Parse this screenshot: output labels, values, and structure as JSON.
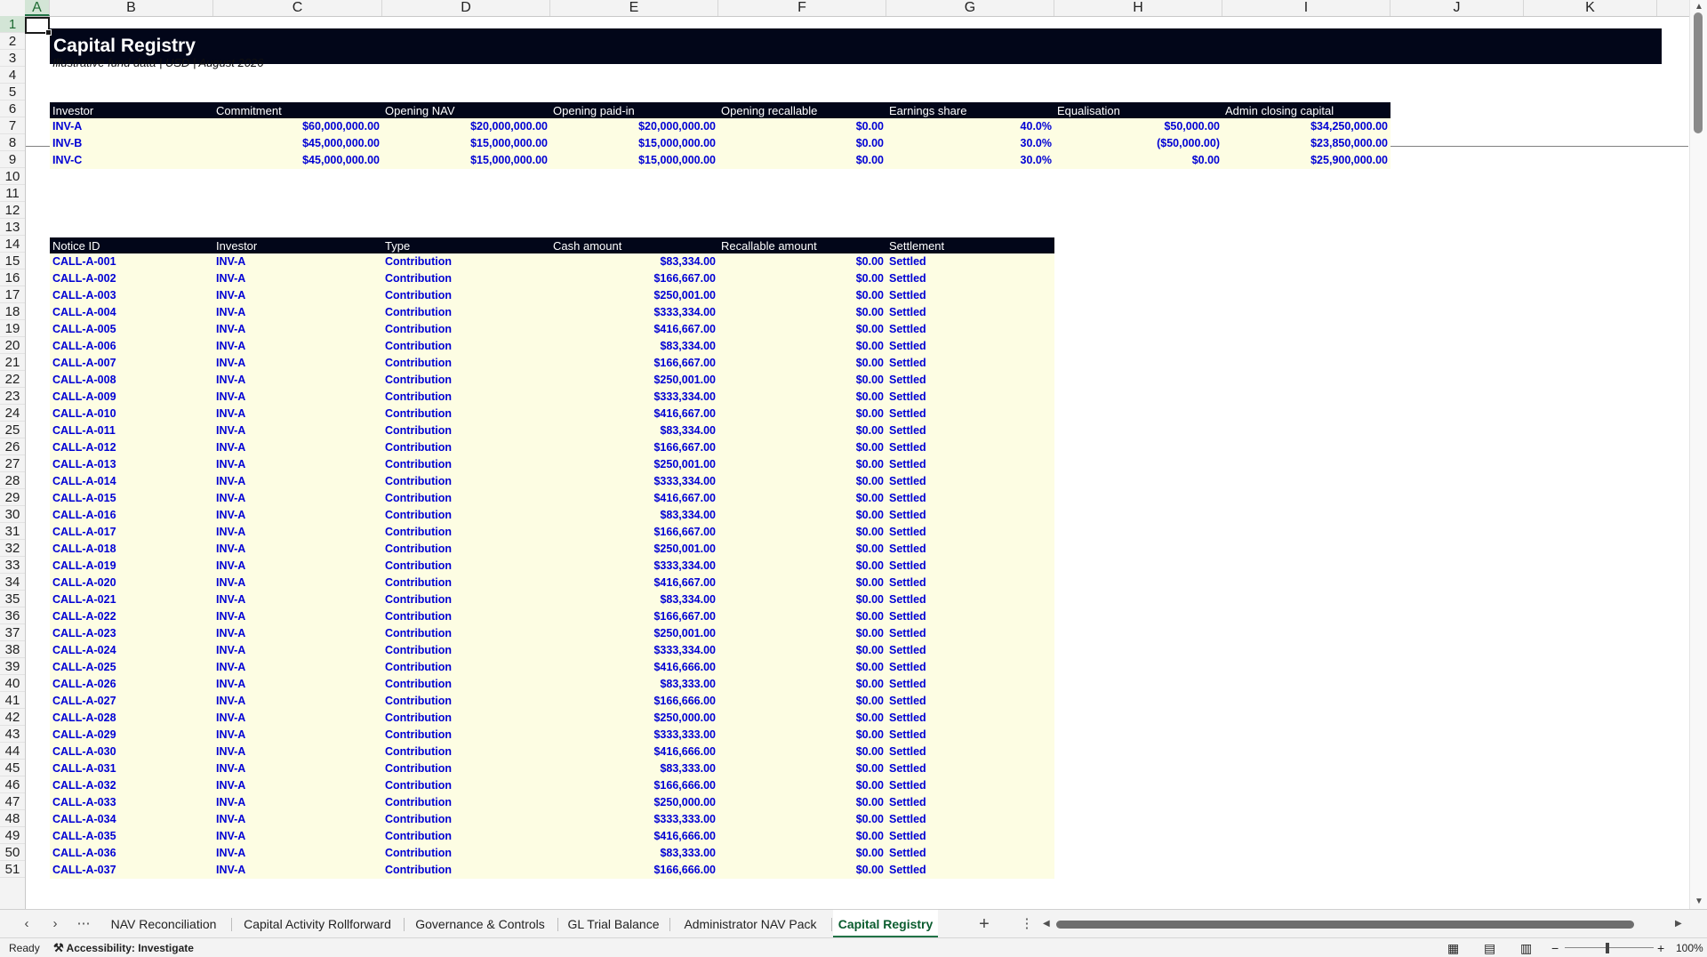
{
  "columns": [
    "A",
    "B",
    "C",
    "D",
    "E",
    "F",
    "G",
    "H",
    "I",
    "J",
    "K"
  ],
  "rows_start": 1,
  "rows_end": 51,
  "selected_cell": "A1",
  "title": "Capital Registry",
  "subtitle": "Illustrative fund data | USD | August 2026",
  "investor_table": {
    "headers": [
      "Investor",
      "Commitment",
      "Opening NAV",
      "Opening paid-in",
      "Opening recallable",
      "Earnings share",
      "Equalisation",
      "Admin closing capital"
    ],
    "rows": [
      [
        "INV-A",
        "$60,000,000.00",
        "$20,000,000.00",
        "$20,000,000.00",
        "$0.00",
        "40.0%",
        "$50,000.00",
        "$34,250,000.00"
      ],
      [
        "INV-B",
        "$45,000,000.00",
        "$15,000,000.00",
        "$15,000,000.00",
        "$0.00",
        "30.0%",
        "($50,000.00)",
        "$23,850,000.00"
      ],
      [
        "INV-C",
        "$45,000,000.00",
        "$15,000,000.00",
        "$15,000,000.00",
        "$0.00",
        "30.0%",
        "$0.00",
        "$25,900,000.00"
      ]
    ]
  },
  "notice_table": {
    "headers": [
      "Notice ID",
      "Investor",
      "Type",
      "Cash amount",
      "Recallable amount",
      "Settlement"
    ],
    "rows": [
      [
        "CALL-A-001",
        "INV-A",
        "Contribution",
        "$83,334.00",
        "$0.00",
        "Settled"
      ],
      [
        "CALL-A-002",
        "INV-A",
        "Contribution",
        "$166,667.00",
        "$0.00",
        "Settled"
      ],
      [
        "CALL-A-003",
        "INV-A",
        "Contribution",
        "$250,001.00",
        "$0.00",
        "Settled"
      ],
      [
        "CALL-A-004",
        "INV-A",
        "Contribution",
        "$333,334.00",
        "$0.00",
        "Settled"
      ],
      [
        "CALL-A-005",
        "INV-A",
        "Contribution",
        "$416,667.00",
        "$0.00",
        "Settled"
      ],
      [
        "CALL-A-006",
        "INV-A",
        "Contribution",
        "$83,334.00",
        "$0.00",
        "Settled"
      ],
      [
        "CALL-A-007",
        "INV-A",
        "Contribution",
        "$166,667.00",
        "$0.00",
        "Settled"
      ],
      [
        "CALL-A-008",
        "INV-A",
        "Contribution",
        "$250,001.00",
        "$0.00",
        "Settled"
      ],
      [
        "CALL-A-009",
        "INV-A",
        "Contribution",
        "$333,334.00",
        "$0.00",
        "Settled"
      ],
      [
        "CALL-A-010",
        "INV-A",
        "Contribution",
        "$416,667.00",
        "$0.00",
        "Settled"
      ],
      [
        "CALL-A-011",
        "INV-A",
        "Contribution",
        "$83,334.00",
        "$0.00",
        "Settled"
      ],
      [
        "CALL-A-012",
        "INV-A",
        "Contribution",
        "$166,667.00",
        "$0.00",
        "Settled"
      ],
      [
        "CALL-A-013",
        "INV-A",
        "Contribution",
        "$250,001.00",
        "$0.00",
        "Settled"
      ],
      [
        "CALL-A-014",
        "INV-A",
        "Contribution",
        "$333,334.00",
        "$0.00",
        "Settled"
      ],
      [
        "CALL-A-015",
        "INV-A",
        "Contribution",
        "$416,667.00",
        "$0.00",
        "Settled"
      ],
      [
        "CALL-A-016",
        "INV-A",
        "Contribution",
        "$83,334.00",
        "$0.00",
        "Settled"
      ],
      [
        "CALL-A-017",
        "INV-A",
        "Contribution",
        "$166,667.00",
        "$0.00",
        "Settled"
      ],
      [
        "CALL-A-018",
        "INV-A",
        "Contribution",
        "$250,001.00",
        "$0.00",
        "Settled"
      ],
      [
        "CALL-A-019",
        "INV-A",
        "Contribution",
        "$333,334.00",
        "$0.00",
        "Settled"
      ],
      [
        "CALL-A-020",
        "INV-A",
        "Contribution",
        "$416,667.00",
        "$0.00",
        "Settled"
      ],
      [
        "CALL-A-021",
        "INV-A",
        "Contribution",
        "$83,334.00",
        "$0.00",
        "Settled"
      ],
      [
        "CALL-A-022",
        "INV-A",
        "Contribution",
        "$166,667.00",
        "$0.00",
        "Settled"
      ],
      [
        "CALL-A-023",
        "INV-A",
        "Contribution",
        "$250,001.00",
        "$0.00",
        "Settled"
      ],
      [
        "CALL-A-024",
        "INV-A",
        "Contribution",
        "$333,334.00",
        "$0.00",
        "Settled"
      ],
      [
        "CALL-A-025",
        "INV-A",
        "Contribution",
        "$416,666.00",
        "$0.00",
        "Settled"
      ],
      [
        "CALL-A-026",
        "INV-A",
        "Contribution",
        "$83,333.00",
        "$0.00",
        "Settled"
      ],
      [
        "CALL-A-027",
        "INV-A",
        "Contribution",
        "$166,666.00",
        "$0.00",
        "Settled"
      ],
      [
        "CALL-A-028",
        "INV-A",
        "Contribution",
        "$250,000.00",
        "$0.00",
        "Settled"
      ],
      [
        "CALL-A-029",
        "INV-A",
        "Contribution",
        "$333,333.00",
        "$0.00",
        "Settled"
      ],
      [
        "CALL-A-030",
        "INV-A",
        "Contribution",
        "$416,666.00",
        "$0.00",
        "Settled"
      ],
      [
        "CALL-A-031",
        "INV-A",
        "Contribution",
        "$83,333.00",
        "$0.00",
        "Settled"
      ],
      [
        "CALL-A-032",
        "INV-A",
        "Contribution",
        "$166,666.00",
        "$0.00",
        "Settled"
      ],
      [
        "CALL-A-033",
        "INV-A",
        "Contribution",
        "$250,000.00",
        "$0.00",
        "Settled"
      ],
      [
        "CALL-A-034",
        "INV-A",
        "Contribution",
        "$333,333.00",
        "$0.00",
        "Settled"
      ],
      [
        "CALL-A-035",
        "INV-A",
        "Contribution",
        "$416,666.00",
        "$0.00",
        "Settled"
      ],
      [
        "CALL-A-036",
        "INV-A",
        "Contribution",
        "$83,333.00",
        "$0.00",
        "Settled"
      ],
      [
        "CALL-A-037",
        "INV-A",
        "Contribution",
        "$166,666.00",
        "$0.00",
        "Settled"
      ]
    ]
  },
  "sheet_tabs": [
    "NAV Reconciliation",
    "Capital Activity Rollforward",
    "Governance & Controls",
    "GL Trial Balance",
    "Administrator NAV Pack",
    "Capital Registry"
  ],
  "active_tab": "Capital Registry",
  "status": {
    "ready": "Ready",
    "accessibility": "Accessibility: Investigate",
    "zoom": "100%"
  },
  "icons": {
    "prev_sheet": "chevron-left-icon",
    "next_sheet": "chevron-right-icon",
    "more_sheets": "ellipsis-icon",
    "add_sheet": "plus-icon",
    "options": "vertical-ellipsis-icon",
    "accessibility": "accessibility-icon",
    "normal_view": "normal-view-icon",
    "page_layout": "page-layout-icon",
    "page_break": "page-break-preview-icon"
  },
  "colors": {
    "header_fill": "#020619",
    "band_fill": "#fdfde3",
    "data_text": "#0000d4",
    "accent": "#217346"
  }
}
